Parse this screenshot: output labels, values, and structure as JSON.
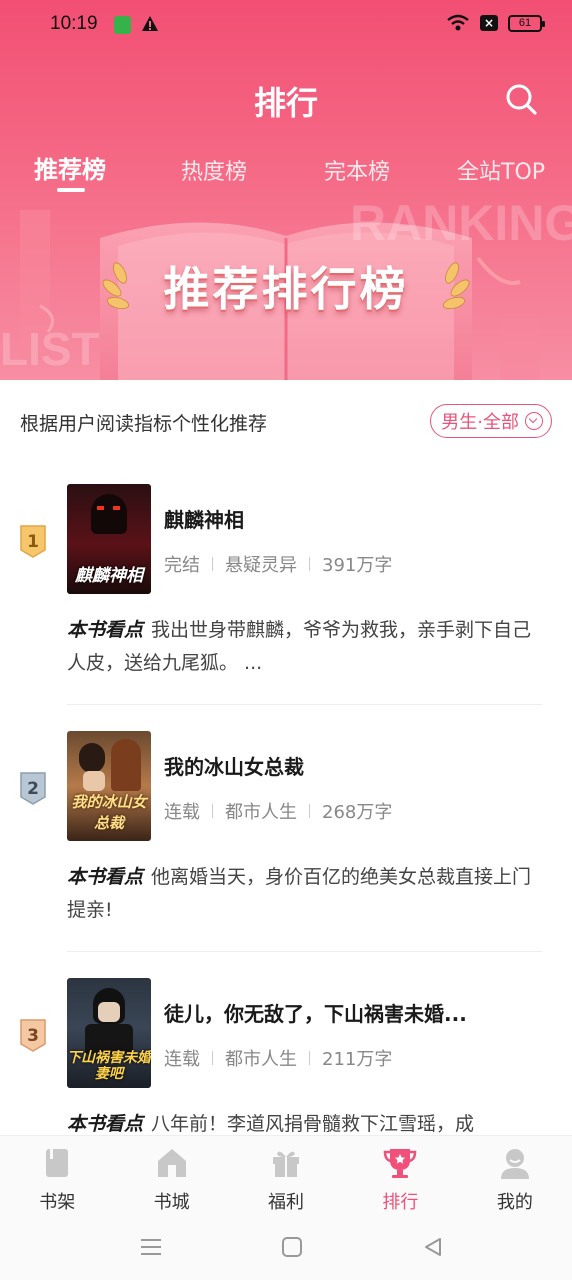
{
  "status": {
    "time": "10:19",
    "battery": "61"
  },
  "header": {
    "title": "排行"
  },
  "tabs": [
    {
      "label": "推荐榜",
      "active": true
    },
    {
      "label": "热度榜",
      "active": false
    },
    {
      "label": "完本榜",
      "active": false
    },
    {
      "label": "全站TOP",
      "active": false
    }
  ],
  "banner": {
    "title": "推荐排行榜",
    "watermark_top": "RANKING",
    "watermark_bottom": "LIST"
  },
  "subheader": {
    "text": "根据用户阅读指标个性化推荐",
    "filter_label": "男生·全部"
  },
  "books": [
    {
      "rank": "1",
      "title": "麒麟神相",
      "status": "完结",
      "genre": "悬疑灵异",
      "words": "391万字",
      "highlight_label": "本书看点",
      "desc": "我出世身带麒麟，爷爷为救我，亲手剥下自己人皮，送给九尾狐。 ...",
      "cover_text": "麒麟神相"
    },
    {
      "rank": "2",
      "title": "我的冰山女总裁",
      "status": "连载",
      "genre": "都市人生",
      "words": "268万字",
      "highlight_label": "本书看点",
      "desc": "他离婚当天，身价百亿的绝美女总裁直接上门提亲!",
      "cover_text": "我的冰山女总裁"
    },
    {
      "rank": "3",
      "title": "徒儿，你无敌了，下山祸害未婚...",
      "status": "连载",
      "genre": "都市人生",
      "words": "211万字",
      "highlight_label": "本书看点",
      "desc": "八年前！李道风捐骨髓救下江雪瑶，成",
      "cover_text": "下山祸害未婚妻吧"
    }
  ],
  "nav": [
    {
      "label": "书架",
      "icon": "bookshelf-icon",
      "active": false
    },
    {
      "label": "书城",
      "icon": "bookstore-icon",
      "active": false
    },
    {
      "label": "福利",
      "icon": "gift-icon",
      "active": false
    },
    {
      "label": "排行",
      "icon": "trophy-icon",
      "active": true
    },
    {
      "label": "我的",
      "icon": "profile-icon",
      "active": false
    }
  ],
  "colors": {
    "accent": "#f0507a",
    "header_top": "#f24f73",
    "gold": "#f5c46a"
  }
}
